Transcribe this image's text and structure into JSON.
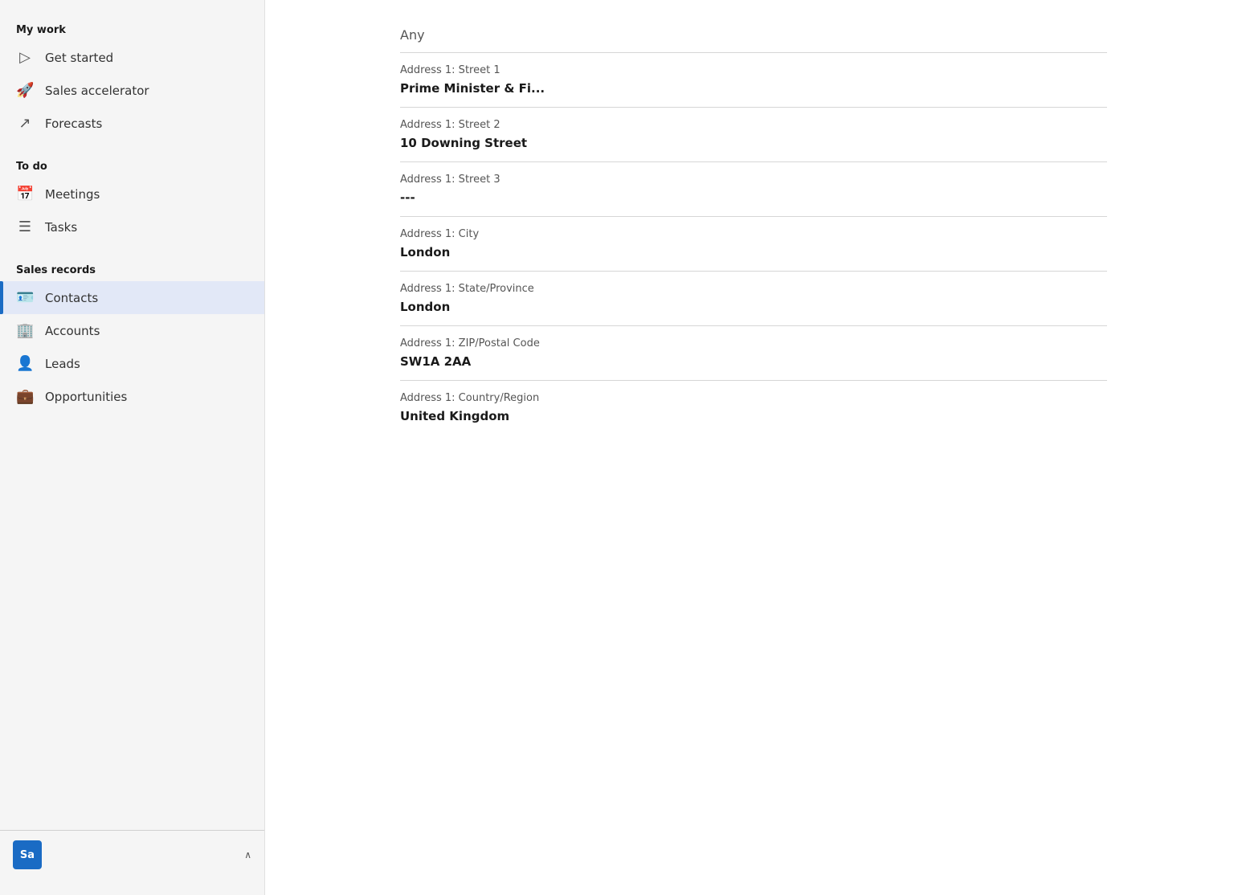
{
  "sidebar": {
    "sections": [
      {
        "header": "My work",
        "items": [
          {
            "id": "get-started",
            "label": "Get started",
            "icon": "▷",
            "active": false
          },
          {
            "id": "sales-accelerator",
            "label": "Sales accelerator",
            "icon": "🚀",
            "active": false
          },
          {
            "id": "forecasts",
            "label": "Forecasts",
            "icon": "↗",
            "active": false
          }
        ]
      },
      {
        "header": "To do",
        "items": [
          {
            "id": "meetings",
            "label": "Meetings",
            "icon": "📅",
            "active": false
          },
          {
            "id": "tasks",
            "label": "Tasks",
            "icon": "☰",
            "active": false
          }
        ]
      },
      {
        "header": "Sales records",
        "items": [
          {
            "id": "contacts",
            "label": "Contacts",
            "icon": "🪪",
            "active": true
          },
          {
            "id": "accounts",
            "label": "Accounts",
            "icon": "🏢",
            "active": false
          },
          {
            "id": "leads",
            "label": "Leads",
            "icon": "👤",
            "active": false
          },
          {
            "id": "opportunities",
            "label": "Opportunities",
            "icon": "💼",
            "active": false
          }
        ]
      }
    ],
    "bottom": {
      "avatar_text": "Sa",
      "chevron": "∧"
    }
  },
  "form": {
    "top_any": "Any",
    "fields": [
      {
        "label": "Address 1: Street 1",
        "value": "Prime Minister & Fi...",
        "bold": true
      },
      {
        "label": "Address 1: Street 2",
        "value": "10 Downing Street",
        "bold": true
      },
      {
        "label": "Address 1: Street 3",
        "value": "---",
        "bold": true
      },
      {
        "label": "Address 1: City",
        "value": "London",
        "bold": true
      },
      {
        "label": "Address 1: State/Province",
        "value": "London",
        "bold": true
      },
      {
        "label": "Address 1: ZIP/Postal Code",
        "value": "SW1A 2AA",
        "bold": true
      },
      {
        "label": "Address 1: Country/Region",
        "value": "United Kingdom",
        "bold": true
      }
    ]
  }
}
